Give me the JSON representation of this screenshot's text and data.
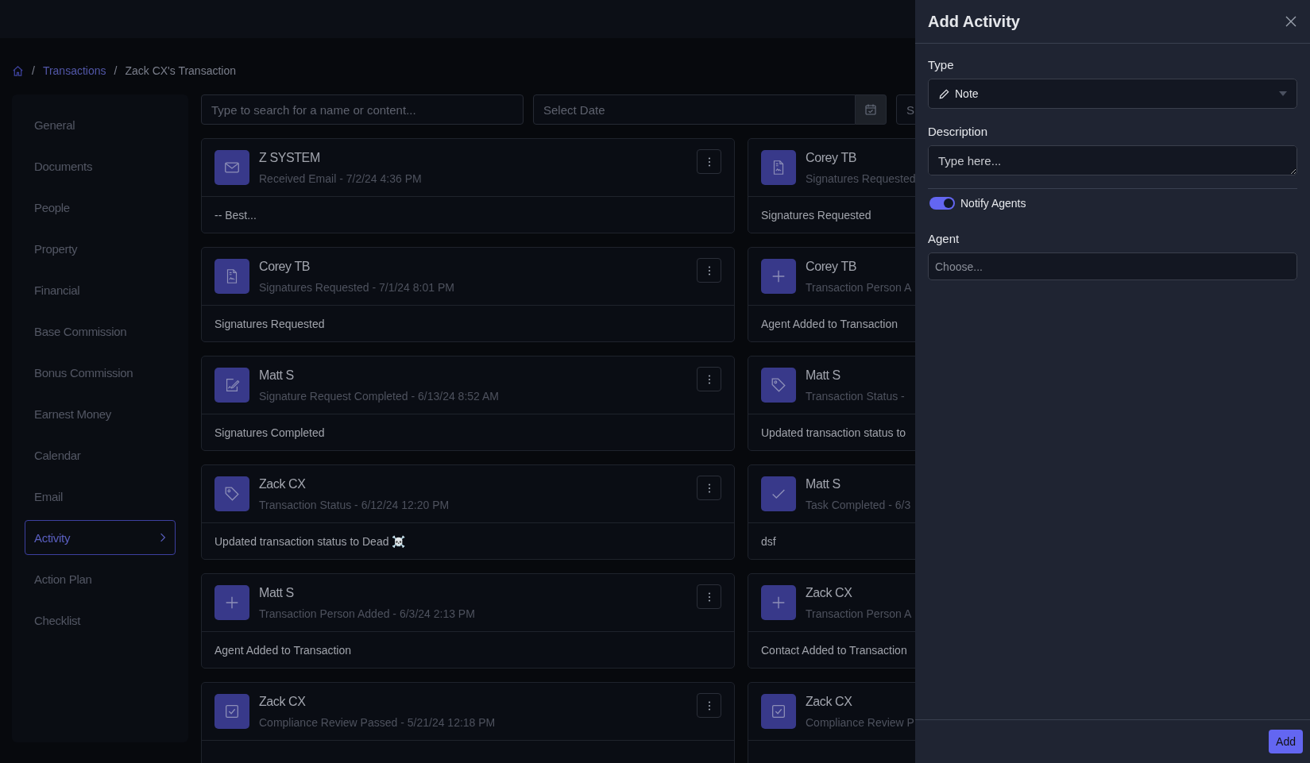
{
  "breadcrumb": {
    "items": [
      {
        "separator": "/",
        "label": "Transactions",
        "link": true
      },
      {
        "separator": "/",
        "label": "Zack CX's Transaction",
        "link": false
      }
    ]
  },
  "sidebar": {
    "items": [
      {
        "label": "General",
        "selected": false
      },
      {
        "label": "Documents",
        "selected": false
      },
      {
        "label": "People",
        "selected": false
      },
      {
        "label": "Property",
        "selected": false
      },
      {
        "label": "Financial",
        "selected": false
      },
      {
        "label": "Base Commission",
        "selected": false
      },
      {
        "label": "Bonus Commission",
        "selected": false
      },
      {
        "label": "Earnest Money",
        "selected": false
      },
      {
        "label": "Calendar",
        "selected": false
      },
      {
        "label": "Email",
        "selected": false
      },
      {
        "label": "Activity",
        "selected": true
      },
      {
        "label": "Action Plan",
        "selected": false
      },
      {
        "label": "Checklist",
        "selected": false
      }
    ]
  },
  "filters": {
    "search": {
      "placeholder": "Type to search for a name or content..."
    },
    "date": {
      "placeholder": "Select Date"
    },
    "filter_3": {
      "placeholder": "S"
    }
  },
  "activities": [
    {
      "kind": "email",
      "name": "Z SYSTEM",
      "subtitle": "Received Email - 7/2/24 4:36 PM",
      "body": "-- Best...",
      "menu": true
    },
    {
      "kind": "signature",
      "name": "Corey TB",
      "subtitle": "Signatures Requested",
      "body": "Signatures Requested"
    },
    {
      "kind": "signature",
      "name": "Corey TB",
      "subtitle": "Signatures Requested - 7/1/24 8:01 PM",
      "body": "Signatures Requested",
      "menu": true
    },
    {
      "kind": "plus",
      "name": "Corey TB",
      "subtitle": "Transaction Person A",
      "body": "Agent Added to Transaction"
    },
    {
      "kind": "signed",
      "name": "Matt S",
      "subtitle": "Signature Request Completed - 6/13/24 8:52 AM",
      "body": "Signatures Completed",
      "menu": true
    },
    {
      "kind": "tag",
      "name": "Matt S",
      "subtitle": "Transaction Status -",
      "body": "Updated transaction status to"
    },
    {
      "kind": "tag",
      "name": "Zack CX",
      "subtitle": "Transaction Status - 6/12/24 12:20 PM",
      "body": "Updated transaction status to Dead ☠️",
      "menu": true
    },
    {
      "kind": "check",
      "name": "Matt S",
      "subtitle": "Task Completed - 6/3",
      "body": "dsf"
    },
    {
      "kind": "plus",
      "name": "Matt S",
      "subtitle": "Transaction Person Added - 6/3/24 2:13 PM",
      "body": "Agent Added to Transaction",
      "menu": true
    },
    {
      "kind": "plus",
      "name": "Zack CX",
      "subtitle": "Transaction Person A",
      "body": "Contact Added to Transaction"
    },
    {
      "kind": "compliance",
      "name": "Zack CX",
      "subtitle": "Compliance Review Passed - 5/21/24 12:18 PM",
      "menu": true
    },
    {
      "kind": "compliance",
      "name": "Zack CX",
      "subtitle": "Compliance Review P"
    }
  ],
  "panel": {
    "title": "Add Activity",
    "type": {
      "label": "Type",
      "value": "Note"
    },
    "description": {
      "label": "Description",
      "placeholder": "Type here..."
    },
    "notify": {
      "label": "Notify Agents",
      "on": true
    },
    "agent": {
      "label": "Agent",
      "placeholder": "Choose..."
    },
    "buttons": [
      "Add"
    ]
  }
}
